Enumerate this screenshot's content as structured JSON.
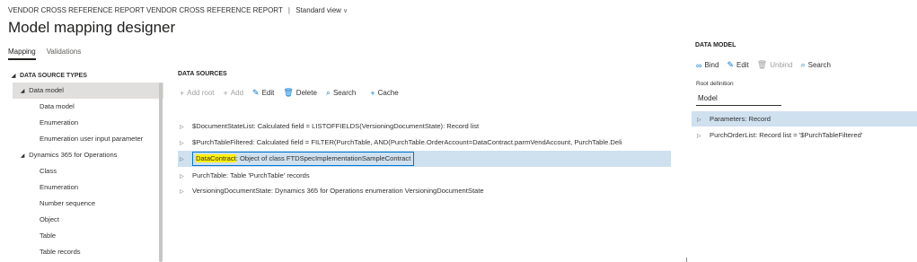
{
  "breadcrumb": {
    "path": "VENDOR CROSS REFERENCE REPORT VENDOR CROSS REFERENCE REPORT",
    "separator": "|",
    "view": "Standard view"
  },
  "page": {
    "title": "Model mapping designer"
  },
  "tabs": [
    {
      "label": "Mapping",
      "active": true
    },
    {
      "label": "Validations",
      "active": false
    }
  ],
  "data_source_types": {
    "header": "DATA SOURCE TYPES",
    "items": [
      {
        "label": "Data model",
        "level": 1,
        "expanded": true,
        "selected": true
      },
      {
        "label": "Data model",
        "level": 2
      },
      {
        "label": "Enumeration",
        "level": 2
      },
      {
        "label": "Enumeration user input parameter",
        "level": 2
      },
      {
        "label": "Dynamics 365 for Operations",
        "level": 1,
        "expanded": true
      },
      {
        "label": "Class",
        "level": 2
      },
      {
        "label": "Enumeration",
        "level": 2
      },
      {
        "label": "Number sequence",
        "level": 2
      },
      {
        "label": "Object",
        "level": 2
      },
      {
        "label": "Table",
        "level": 2
      },
      {
        "label": "Table records",
        "level": 2
      }
    ]
  },
  "data_sources": {
    "title": "DATA SOURCES",
    "toolbar": {
      "add_root": "Add root",
      "add": "Add",
      "edit": "Edit",
      "delete": "Delete",
      "search": "Search",
      "cache": "Cache"
    },
    "rows": [
      {
        "name": "$DocumentStateList",
        "description": ": Calculated field = LISTOFFIELDS(VersioningDocumentState): Record list"
      },
      {
        "name": "$PurchTableFiltered",
        "description": ": Calculated field = FILTER(PurchTable, AND(PurchTable.OrderAccount=DataContract.parmVendAccount, PurchTable.Deli"
      },
      {
        "name": "DataContract",
        "description": ": Object of class FTDSpecImplementationSampleContract",
        "selected": true
      },
      {
        "name": "PurchTable",
        "description": ": Table 'PurchTable' records"
      },
      {
        "name": "VersioningDocumentState",
        "description": ": Dynamics 365 for Operations enumeration VersioningDocumentState"
      }
    ]
  },
  "data_model": {
    "title": "DATA MODEL",
    "toolbar": {
      "bind": "Bind",
      "edit": "Edit",
      "unbind": "Unbind",
      "search": "Search"
    },
    "root_label": "Root definition",
    "root_value": "Model",
    "rows": [
      {
        "label": "Parameters: Record",
        "selected": true
      },
      {
        "label": "PurchOrderList: Record list = '$PurchTableFiltered'"
      }
    ]
  }
}
